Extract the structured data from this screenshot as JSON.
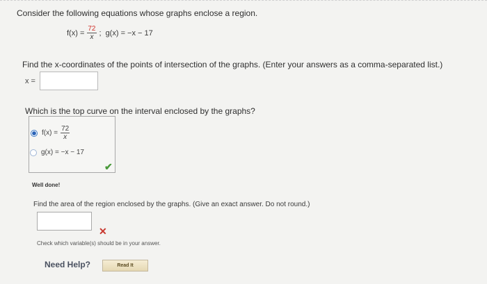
{
  "question": {
    "intro": "Consider the following equations whose graphs enclose a region.",
    "f_lhs": "f(x) =",
    "f_num": "72",
    "f_den": "x",
    "sep": ";",
    "g_eq": "g(x) = −x − 17",
    "find_x": "Find the x-coordinates of the points of intersection of the graphs. (Enter your answers as a comma-separated list.)",
    "x_label": "x =",
    "x_value": "",
    "which_top": "Which is the top curve on the interval enclosed by the graphs?",
    "option1_lhs": "f(x) =",
    "option1_num": "72",
    "option1_den": "x",
    "option2": "g(x) = −x − 17",
    "selected_option": "option1",
    "well_done": "Well done!",
    "find_area": "Find the area of the region enclosed by the graphs. (Give an exact answer. Do not round.)",
    "area_value": "",
    "check_msg": "Check which variable(s) should be in your answer.",
    "need_help": "Need Help?",
    "read_it": "Read It"
  },
  "colors": {
    "accent_red": "#d0342c",
    "check_green": "#4a9a3a",
    "radio_blue": "#2a63b8"
  }
}
